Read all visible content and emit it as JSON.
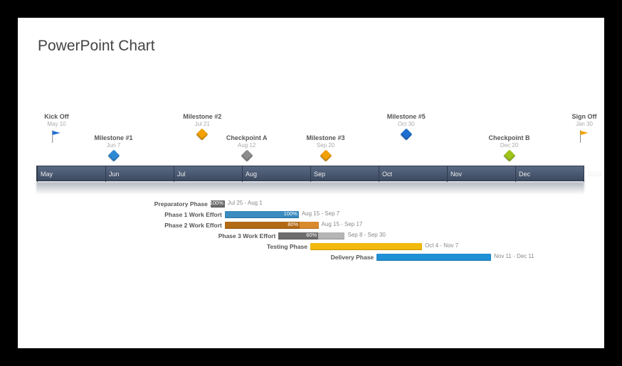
{
  "title": "PowerPoint Chart",
  "chart_data": {
    "type": "bar",
    "title": "PowerPoint Chart",
    "timeline": {
      "start": "May",
      "end_label": "2019",
      "ticks": [
        "May",
        "Jun",
        "Jul",
        "Aug",
        "Sep",
        "Oct",
        "Nov",
        "Dec",
        "2019"
      ]
    },
    "milestones": [
      {
        "label": "Kick Off",
        "date": "May 10",
        "pos": 3.7,
        "shape": "flag",
        "color": "#1f6fd0",
        "row": 0
      },
      {
        "label": "Milestone #1",
        "date": "Jun 7",
        "pos": 14.1,
        "shape": "diamond",
        "color": "#2f8ad6",
        "row": 1
      },
      {
        "label": "Milestone #2",
        "date": "Jul 21",
        "pos": 30.3,
        "shape": "diamond",
        "color": "#f2a100",
        "row": 0
      },
      {
        "label": "Checkpoint A",
        "date": "Aug 12",
        "pos": 38.4,
        "shape": "diamond",
        "color": "#8c8c8c",
        "row": 1
      },
      {
        "label": "Milestone #3",
        "date": "Sep 20",
        "pos": 52.8,
        "shape": "diamond",
        "color": "#f2a100",
        "row": 1
      },
      {
        "label": "Milestone #5",
        "date": "Oct 30",
        "pos": 67.5,
        "shape": "diamond",
        "color": "#1f6fd0",
        "row": 0
      },
      {
        "label": "Checkpoint B",
        "date": "Dec 20",
        "pos": 86.3,
        "shape": "diamond",
        "color": "#9ec41a",
        "row": 1
      },
      {
        "label": "Sign Off",
        "date": "Jan 30",
        "pos": 100.0,
        "shape": "flag",
        "color": "#f2a100",
        "row": 0
      }
    ],
    "tasks": [
      {
        "label": "Preparatory Phase",
        "start": 31.8,
        "end": 34.4,
        "dates": "Jul 25 - Aug 1",
        "pct": "100%",
        "color_bg": "#6d6d6d",
        "color_fill": "#6d6d6d",
        "fill_ratio": 1.0
      },
      {
        "label": "Phase 1 Work Effort",
        "start": 34.4,
        "end": 47.9,
        "dates": "Aug 15 - Sep 7",
        "pct": "100%",
        "color_bg": "#3a8bbf",
        "color_fill": "#3a8bbf",
        "fill_ratio": 1.0
      },
      {
        "label": "Phase 2 Work Effort",
        "start": 34.4,
        "end": 51.5,
        "dates": "Aug 15 - Sep 17",
        "pct": "80%",
        "color_bg": "#d98a2b",
        "color_fill": "#b36a15",
        "fill_ratio": 0.8
      },
      {
        "label": "Phase 3 Work Effort",
        "start": 44.2,
        "end": 56.3,
        "dates": "Sep 8 - Sep 30",
        "pct": "60%",
        "color_bg": "#b5b5b5",
        "color_fill": "#6d6d6d",
        "fill_ratio": 0.6
      },
      {
        "label": "Testing Phase",
        "start": 50.0,
        "end": 70.4,
        "dates": "Oct 4 - Nov 7",
        "pct": "",
        "color_bg": "#f2b90d",
        "color_fill": "#f2b90d",
        "fill_ratio": 1.0
      },
      {
        "label": "Delivery Phase",
        "start": 62.1,
        "end": 83.0,
        "dates": "Nov 11 - Dec 11",
        "pct": "",
        "color_bg": "#1f8fd6",
        "color_fill": "#1f8fd6",
        "fill_ratio": 1.0
      }
    ]
  }
}
